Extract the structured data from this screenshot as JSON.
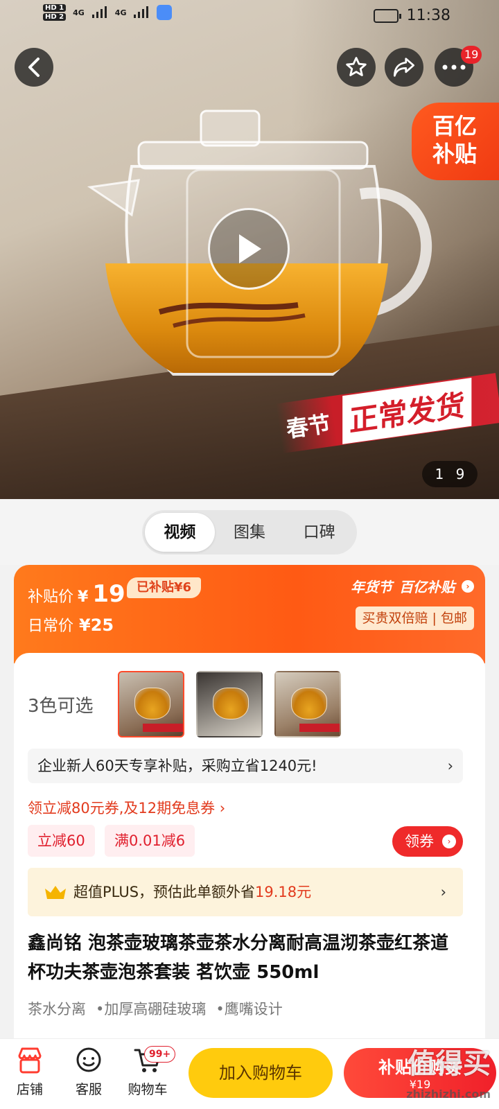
{
  "status_bar": {
    "hd1": "HD 1",
    "hd2": "HD 2",
    "signal1": "4G",
    "signal2": "4G",
    "time": "11:38"
  },
  "header": {
    "more_badge": "19"
  },
  "hero": {
    "subsidy_badge_line1": "百亿",
    "subsidy_badge_line2": "补贴",
    "banner_prefix": "春节",
    "banner_main": "正常发货",
    "pager_current": "1",
    "pager_total": "9"
  },
  "media_tabs": [
    {
      "label": "视频",
      "active": true
    },
    {
      "label": "图集",
      "active": false
    },
    {
      "label": "口碑",
      "active": false
    }
  ],
  "price": {
    "subsidy_label": "补贴价",
    "currency": "¥",
    "subsidy_price": "19",
    "saved_tag": "已补贴¥6",
    "regular_label": "日常价",
    "regular_price": "¥25",
    "brand_tag1": "年货节",
    "brand_tag2": "百亿补贴",
    "guarantee": "买贵双倍赔 | 包邮"
  },
  "variants": {
    "label": "3色可选",
    "thumb_caption": "春节正常发货"
  },
  "promo": {
    "enterprise": "企业新人60天专享补贴，采购立省1240元!",
    "coupon_line": "领立减80元券,及12期免息券 ›",
    "tags": [
      "立减60",
      "满0.01减6"
    ],
    "get_coupon": "领券"
  },
  "plus": {
    "text_prefix": "超值PLUS，预估此单额外省",
    "amount": "19.18元"
  },
  "product": {
    "title": "鑫尚铭 泡茶壶玻璃茶壶茶水分离耐高温沏茶壶红茶道杯功夫茶壶泡茶套装 茗饮壶 550ml",
    "features": [
      "茶水分离",
      "•加厚高硼硅玻璃",
      "•鹰嘴设计"
    ]
  },
  "bottom_bar": {
    "store": "店铺",
    "service": "客服",
    "cart": "购物车",
    "cart_badge": "99+",
    "add_to_cart": "加入购物车",
    "buy_now": "补贴价购买",
    "buy_now_price": "¥19"
  },
  "watermark": {
    "main": "值得买",
    "site": "zhizhizhi.com"
  },
  "colors": {
    "accent_orange": "#ff5a14",
    "accent_red": "#ef2a2a",
    "yellow_button": "#ffcb0d"
  }
}
